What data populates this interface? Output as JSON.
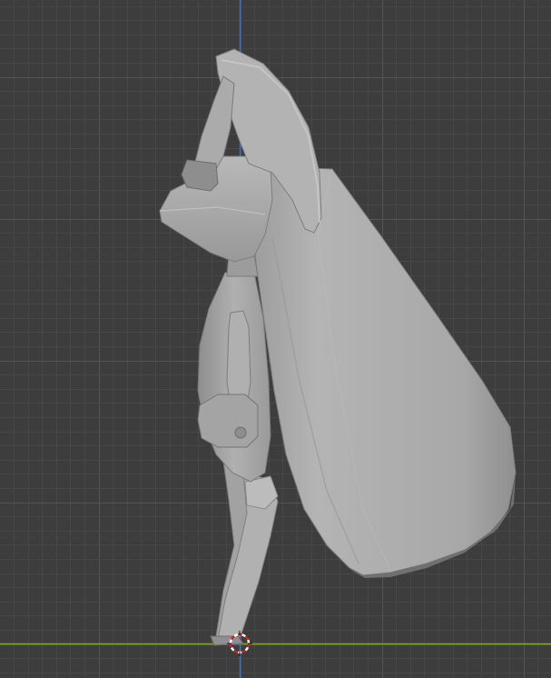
{
  "viewport": {
    "view": "3d-viewport-side",
    "background_color": "#3d3d3d",
    "grid": {
      "minor_line_color": "#474747",
      "major_line_color": "#545454",
      "visible": true
    },
    "axes": {
      "z_axis_color": "#3a6fb5",
      "y_axis_color": "#7aa32a"
    }
  },
  "model": {
    "name": "sculpted-character-mesh",
    "shading": "solid",
    "base_color": "#a9a9a9"
  },
  "cursor": {
    "name": "3d-cursor-icon",
    "ring_colors": [
      "#d01f1f",
      "#ffffff"
    ]
  }
}
